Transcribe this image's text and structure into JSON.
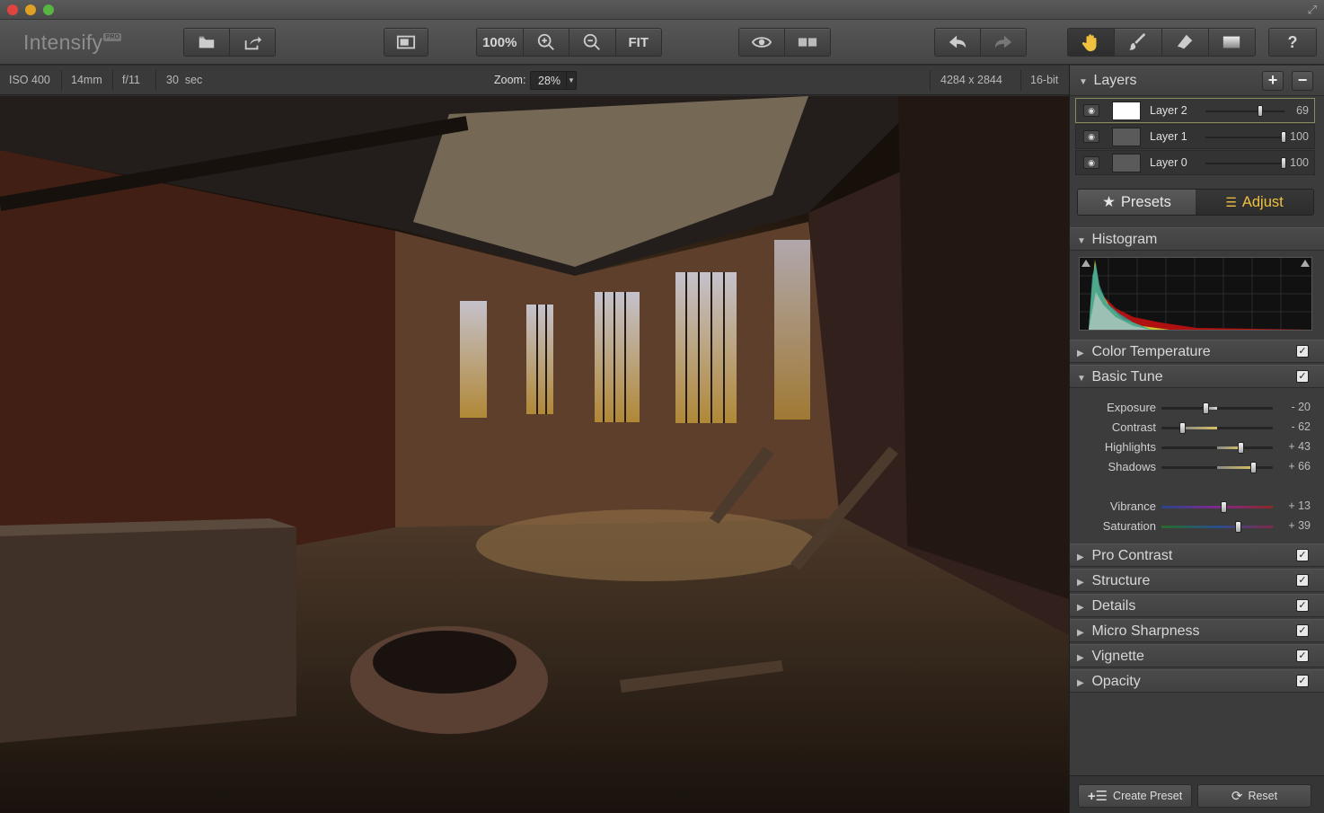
{
  "app": {
    "logo": "Intensify",
    "logo_badge": "PRO"
  },
  "toolbar": {
    "zoom_100_label": "100%",
    "fit_label": "FIT"
  },
  "info": {
    "iso": "ISO 400",
    "focal": "14mm",
    "aperture": "f/11",
    "shutter": "30  sec",
    "zoom_label": "Zoom:",
    "zoom_value": "28%",
    "dimensions": "4284 x 2844",
    "bitdepth": "16-bit"
  },
  "layers": {
    "title": "Layers",
    "items": [
      {
        "name": "Layer 2",
        "value": "69",
        "pos": 0.69,
        "thumb": "#ffffff"
      },
      {
        "name": "Layer 1",
        "value": "100",
        "pos": 1.0,
        "thumb": "#5a5a5a"
      },
      {
        "name": "Layer 0",
        "value": "100",
        "pos": 1.0,
        "thumb": "#5a5a5a"
      }
    ]
  },
  "tabs": {
    "presets": "Presets",
    "adjust": "Adjust"
  },
  "sections": {
    "histogram": "Histogram",
    "color_temperature": "Color Temperature",
    "basic_tune": "Basic Tune",
    "pro_contrast": "Pro Contrast",
    "structure": "Structure",
    "details": "Details",
    "micro_sharpness": "Micro Sharpness",
    "vignette": "Vignette",
    "opacity": "Opacity"
  },
  "basic_tune": [
    {
      "label": "Exposure",
      "value": "- 20",
      "pos": 0.4
    },
    {
      "label": "Contrast",
      "value": "- 62",
      "pos": 0.19
    },
    {
      "label": "Highlights",
      "value": "+ 43",
      "pos": 0.72
    },
    {
      "label": "Shadows",
      "value": "+ 66",
      "pos": 0.83
    },
    {
      "label": "Vibrance",
      "value": "+ 13",
      "pos": 0.565
    },
    {
      "label": "Saturation",
      "value": "+ 39",
      "pos": 0.695
    }
  ],
  "footer": {
    "create_preset": "Create Preset",
    "reset": "Reset"
  },
  "colors": {
    "accent": "#f0c040",
    "panel_bg": "#3c3c3c"
  }
}
